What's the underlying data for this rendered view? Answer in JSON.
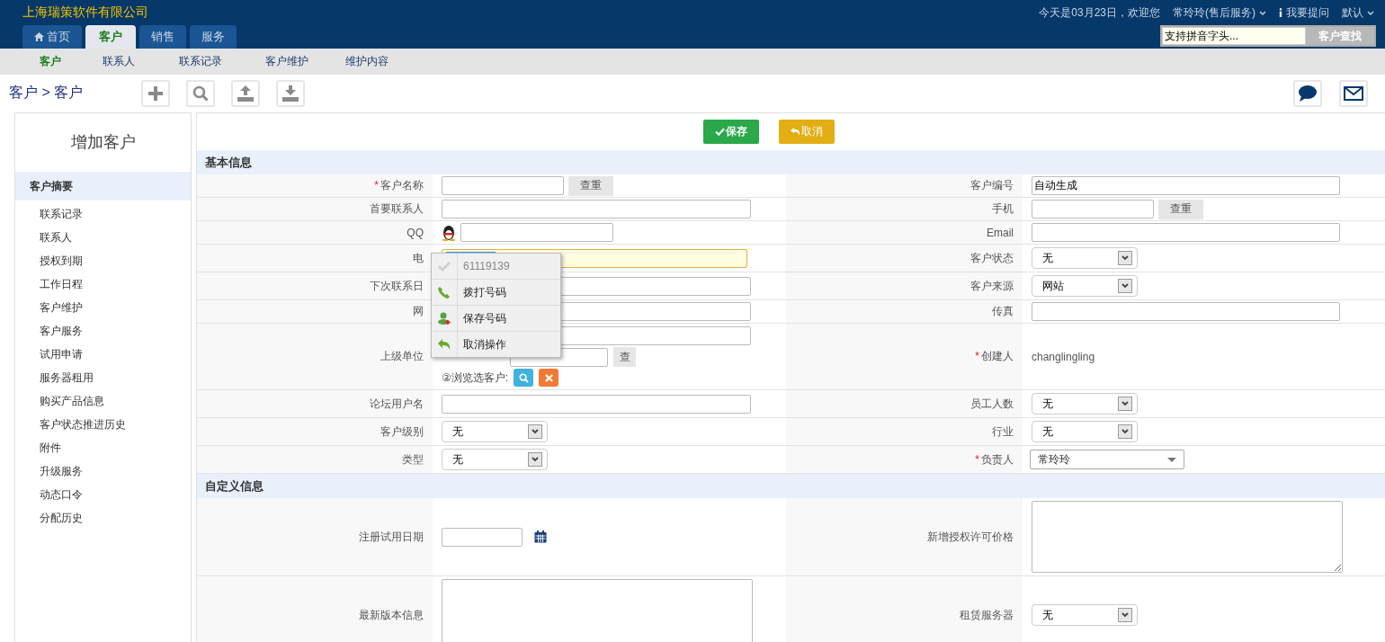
{
  "header": {
    "company": "上海瑞策软件有限公司",
    "greeting": "今天是03月23日，欢迎您",
    "user": "常玲玲(售后服务)",
    "help": "我要提问",
    "theme": "默认",
    "search": {
      "value": "支持拼音字头..."
    },
    "search_button": "客户查找"
  },
  "tabs": [
    {
      "label": "首页",
      "kind": "home",
      "selected": false
    },
    {
      "label": "客户",
      "kind": "plain",
      "selected": true
    },
    {
      "label": "销售",
      "kind": "plain",
      "selected": false
    },
    {
      "label": "服务",
      "kind": "plain",
      "selected": false
    }
  ],
  "subnav": [
    {
      "label": "客户",
      "selected": true
    },
    {
      "label": "联系人",
      "selected": false
    },
    {
      "label": "联系记录",
      "selected": false
    },
    {
      "label": "客户维护",
      "selected": false
    },
    {
      "label": "维护内容",
      "selected": false
    }
  ],
  "breadcrumb": "客户 > 客户",
  "sidebar": {
    "title": "增加客户",
    "items": [
      {
        "label": "客户摘要",
        "selected": true
      },
      {
        "label": "联系记录",
        "selected": false
      },
      {
        "label": "联系人",
        "selected": false
      },
      {
        "label": "授权到期",
        "selected": false
      },
      {
        "label": "工作日程",
        "selected": false
      },
      {
        "label": "客户维护",
        "selected": false
      },
      {
        "label": "客户服务",
        "selected": false
      },
      {
        "label": "试用申请",
        "selected": false
      },
      {
        "label": "服务器租用",
        "selected": false
      },
      {
        "label": "购买产品信息",
        "selected": false
      },
      {
        "label": "客户状态推进历史",
        "selected": false
      },
      {
        "label": "附件",
        "selected": false
      },
      {
        "label": "升级服务",
        "selected": false
      },
      {
        "label": "动态口令",
        "selected": false
      },
      {
        "label": "分配历史",
        "selected": false
      }
    ]
  },
  "actions": [
    {
      "label": "保存",
      "kind": "save"
    },
    {
      "label": "取消",
      "kind": "cancel"
    }
  ],
  "sections": [
    {
      "title": "基本信息",
      "rows": [
        {
          "cells": [
            {
              "label": "客户名称",
              "marker": "*",
              "field": {
                "kind": "input_check",
                "button": "查重"
              }
            },
            {
              "label": "客户编号",
              "field": {
                "kind": "input",
                "value": "自动生成"
              }
            }
          ]
        },
        {
          "cells": [
            {
              "label": "首要联系人",
              "field": {
                "kind": "input"
              }
            },
            {
              "label": "手机",
              "field": {
                "kind": "input_check",
                "button": "查重"
              }
            }
          ]
        },
        {
          "cells": [
            {
              "label": "QQ",
              "field": {
                "kind": "qq"
              }
            },
            {
              "label": "Email",
              "field": {
                "kind": "input"
              }
            }
          ]
        },
        {
          "cells": [
            {
              "label": "电",
              "field": {
                "kind": "phone",
                "focused": true
              }
            },
            {
              "label": "客户状态",
              "field": {
                "kind": "select",
                "value": "无"
              }
            }
          ]
        },
        {
          "cells": [
            {
              "label": "下次联系日",
              "field": {
                "kind": "input"
              }
            },
            {
              "label": "客户来源",
              "field": {
                "kind": "select",
                "value": "网站"
              }
            }
          ]
        },
        {
          "cells": [
            {
              "label": "网",
              "field": {
                "kind": "input"
              }
            },
            {
              "label": "传真",
              "field": {
                "kind": "input"
              }
            }
          ]
        },
        {
          "cells": [
            {
              "label": "上级单位",
              "field": {
                "kind": "parent",
                "button": "查",
                "browse": "②浏览选客户:"
              }
            },
            {
              "label": "创建人",
              "marker": "*",
              "field": {
                "kind": "text",
                "value": "changlingling"
              }
            }
          ]
        },
        {
          "cells": [
            {
              "label": "论坛用户名",
              "field": {
                "kind": "input"
              }
            },
            {
              "label": "员工人数",
              "field": {
                "kind": "select",
                "value": "无"
              }
            }
          ]
        },
        {
          "cells": [
            {
              "label": "客户级别",
              "field": {
                "kind": "select",
                "value": "无"
              }
            },
            {
              "label": "行业",
              "field": {
                "kind": "select",
                "value": "无"
              }
            }
          ]
        },
        {
          "cells": [
            {
              "label": "类型",
              "field": {
                "kind": "select",
                "value": "无"
              }
            },
            {
              "label": "负责人",
              "marker": "*",
              "field": {
                "kind": "combo",
                "value": "常玲玲"
              }
            }
          ]
        }
      ]
    },
    {
      "title": "自定义信息",
      "rows": [
        {
          "cells": [
            {
              "label": "注册试用日期",
              "field": {
                "kind": "date"
              }
            },
            {
              "label": "新增授权许可价格",
              "field": {
                "kind": "textarea"
              }
            }
          ]
        },
        {
          "cells": [
            {
              "label": "最新版本信息",
              "field": {
                "kind": "textarea"
              }
            },
            {
              "label": "租赁服务器",
              "field": {
                "kind": "select",
                "value": "无"
              }
            }
          ]
        }
      ]
    }
  ],
  "popup": {
    "items": [
      {
        "label": "61119139",
        "kind": "number",
        "disabled": true
      },
      {
        "label": "拨打号码",
        "kind": "dial",
        "disabled": false
      },
      {
        "label": "保存号码",
        "kind": "save",
        "disabled": false
      },
      {
        "label": "取消操作",
        "kind": "undo",
        "disabled": false
      }
    ]
  }
}
